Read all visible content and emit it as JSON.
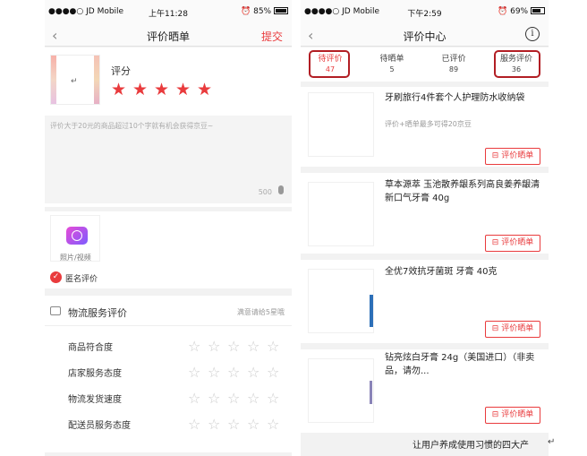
{
  "left": {
    "status": {
      "carrier": "●●●●○ JD Mobile",
      "time": "上午11:28",
      "battery": "85%",
      "battery_level": 0.85
    },
    "nav": {
      "back": "‹",
      "title": "评价晒单",
      "submit": "提交"
    },
    "product": {
      "rating_label": "评分",
      "rating_value": 5,
      "placeholder": "评价大于20元的商品超过10个字就有机会获得京豆~",
      "char_limit": "500",
      "thumb_mark": "↵"
    },
    "media": {
      "upload_label": "照片/视频"
    },
    "anonymous": {
      "label": "匿名评价",
      "checked": true
    },
    "service": {
      "title": "物流服务评价",
      "hint": "满意请给5星哦",
      "items": [
        {
          "label": "商品符合度"
        },
        {
          "label": "店家服务态度"
        },
        {
          "label": "物流发货速度"
        },
        {
          "label": "配送员服务态度"
        }
      ]
    }
  },
  "right": {
    "status": {
      "carrier": "●●●●○ JD Mobile",
      "time": "下午2:59",
      "battery": "69%",
      "battery_level": 0.69
    },
    "nav": {
      "back": "‹",
      "title": "评价中心",
      "info": "i"
    },
    "tabs": [
      {
        "label": "待评价",
        "count": "47",
        "active": true,
        "highlighted": true
      },
      {
        "label": "待晒单",
        "count": "5",
        "active": false,
        "highlighted": false
      },
      {
        "label": "已评价",
        "count": "89",
        "active": false,
        "highlighted": false
      },
      {
        "label": "服务评价",
        "count": "36",
        "active": false,
        "highlighted": true
      }
    ],
    "products": [
      {
        "title": "牙刷旅行4件套个人护理防水收纳袋",
        "subtitle": "评价+晒单最多可得20京豆",
        "button": "评价晒单"
      },
      {
        "title": "草本源萃 玉池散养龈系列高良姜养龈清新口气牙膏 40g",
        "button": "评价晒单"
      },
      {
        "title": "全优7效抗牙菌斑 牙膏 40克",
        "button": "评价晒单"
      },
      {
        "title": "钻亮炫白牙膏 24g（美国进口）（非卖品，请勿...",
        "button": "评价晒单"
      }
    ],
    "footer_text": "让用户养成使用习惯的四大产"
  },
  "colors": {
    "accent": "#e93b3d",
    "highlight_box": "#b21e24",
    "background": "#f2f2f2"
  },
  "icons": {
    "camera": "video-camera-icon",
    "check": "check-circle-icon",
    "truck": "package-icon",
    "edit": "edit-note-icon",
    "mic": "microphone-icon"
  }
}
